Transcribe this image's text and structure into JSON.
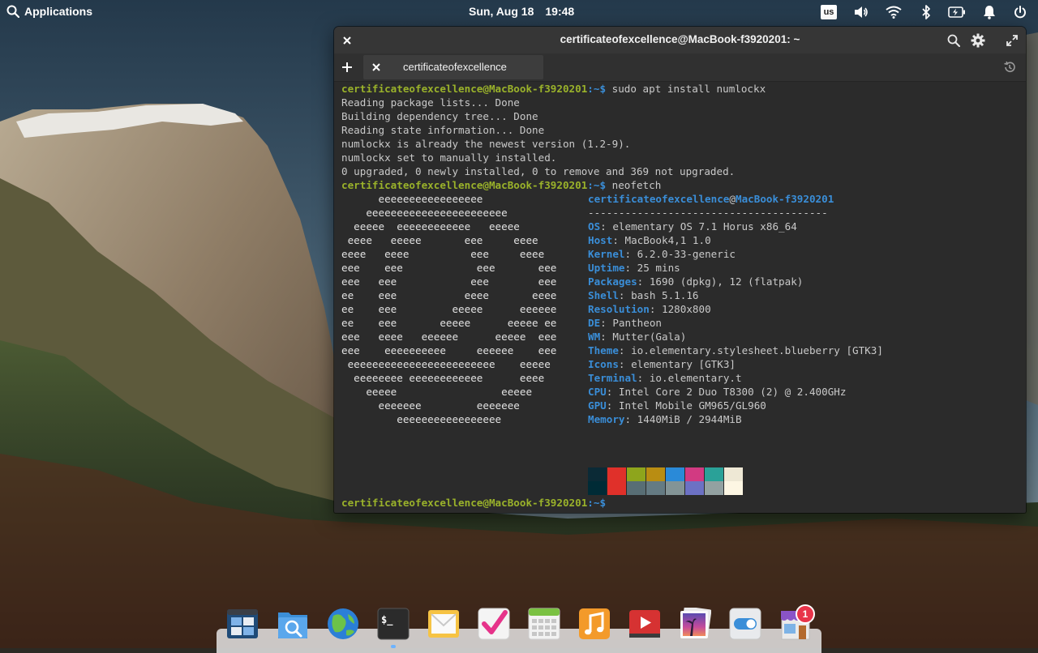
{
  "panel": {
    "applications_label": "Applications",
    "date": "Sun, Aug 18",
    "time": "19:48",
    "keyboard_layout": "us"
  },
  "window": {
    "title": "certificateofexcellence@MacBook-f3920201: ~",
    "tab_label": "certificateofexcellence"
  },
  "terminal": {
    "prompt": "certificateofexcellence@MacBook-f3920201",
    "prompt_suffix": ":~$",
    "command1": " sudo apt install numlockx",
    "output1": [
      "Reading package lists... Done",
      "Building dependency tree... Done",
      "Reading state information... Done",
      "numlockx is already the newest version (1.2-9).",
      "numlockx set to manually installed.",
      "0 upgraded, 0 newly installed, 0 to remove and 369 not upgraded."
    ],
    "command2": " neofetch",
    "logo": [
      "      eeeeeeeeeeeeeeeee",
      "    eeeeeeeeeeeeeeeeeeeeeee",
      "  eeeee  eeeeeeeeeeee   eeeee",
      " eeee   eeeee       eee     eeee",
      "eeee   eeee          eee     eeee",
      "eee    eee            eee       eee",
      "eee   eee            eee        eee",
      "ee    eee           eeee       eeee",
      "ee    eee         eeeee      eeeeee",
      "ee    eee       eeeee      eeeee ee",
      "eee   eeee   eeeeee      eeeee  eee",
      "eee    eeeeeeeeee     eeeeee    eee",
      " eeeeeeeeeeeeeeeeeeeeeeee    eeeee",
      "  eeeeeeee eeeeeeeeeeee      eeee",
      "    eeeee                 eeeee",
      "      eeeeeee         eeeeeee",
      "         eeeeeeeeeeeeeeeee"
    ],
    "user": "certificateofexcellence",
    "at": "@",
    "host": "MacBook-f3920201",
    "separator": "---------------------------------------",
    "info": [
      {
        "key": "OS",
        "value": ": elementary OS 7.1 Horus x86_64"
      },
      {
        "key": "Host",
        "value": ": MacBook4,1 1.0"
      },
      {
        "key": "Kernel",
        "value": ": 6.2.0-33-generic"
      },
      {
        "key": "Uptime",
        "value": ": 25 mins"
      },
      {
        "key": "Packages",
        "value": ": 1690 (dpkg), 12 (flatpak)"
      },
      {
        "key": "Shell",
        "value": ": bash 5.1.16"
      },
      {
        "key": "Resolution",
        "value": ": 1280x800"
      },
      {
        "key": "DE",
        "value": ": Pantheon"
      },
      {
        "key": "WM",
        "value": ": Mutter(Gala)"
      },
      {
        "key": "Theme",
        "value": ": io.elementary.stylesheet.blueberry [GTK3]"
      },
      {
        "key": "Icons",
        "value": ": elementary [GTK3]"
      },
      {
        "key": "Terminal",
        "value": ": io.elementary.t"
      },
      {
        "key": "CPU",
        "value": ": Intel Core 2 Duo T8300 (2) @ 2.400GHz"
      },
      {
        "key": "GPU",
        "value": ": Intel Mobile GM965/GL960"
      },
      {
        "key": "Memory",
        "value": ": 1440MiB / 2944MiB"
      }
    ],
    "palette_top": [
      "#0b2a36",
      "#e0302a",
      "#8ea51c",
      "#b98d12",
      "#2a8ad8",
      "#d23a82",
      "#2aa198",
      "#eee8d5"
    ],
    "palette_bottom": [
      "#002b36",
      "#e0302a",
      "#586e75",
      "#657b83",
      "#839496",
      "#6c71c4",
      "#93a1a1",
      "#fdf6e3"
    ]
  },
  "colors": {
    "prompt_green": "#9ab22a",
    "label_blue": "#3a8ed8",
    "terminal_bg": "#2b2b2b",
    "notification_badge": "#e8344a"
  },
  "dock": {
    "items": [
      {
        "name": "multitasking-view",
        "icon": "multitasking-icon"
      },
      {
        "name": "files",
        "icon": "file-search-icon"
      },
      {
        "name": "web-browser",
        "icon": "globe-icon"
      },
      {
        "name": "terminal",
        "icon": "terminal-icon"
      },
      {
        "name": "mail",
        "icon": "mail-icon"
      },
      {
        "name": "tasks",
        "icon": "checkmark-icon"
      },
      {
        "name": "calendar",
        "icon": "calendar-icon"
      },
      {
        "name": "music",
        "icon": "music-note-icon"
      },
      {
        "name": "videos",
        "icon": "play-icon"
      },
      {
        "name": "photos",
        "icon": "photos-icon"
      },
      {
        "name": "settings",
        "icon": "toggle-icon"
      },
      {
        "name": "appcenter",
        "icon": "store-icon"
      }
    ],
    "terminal_prompt_glyph": "$_",
    "appcenter_badge": "1"
  }
}
